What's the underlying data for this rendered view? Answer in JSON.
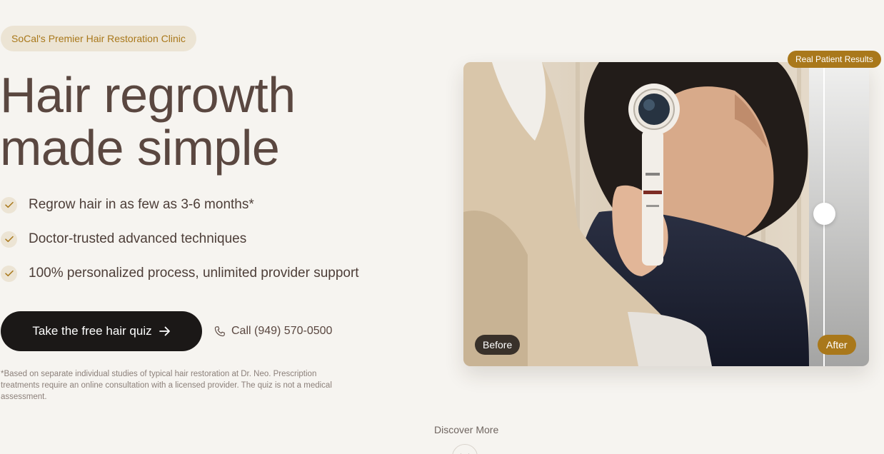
{
  "hero": {
    "eyebrow": "SoCal's Premier Hair Restoration Clinic",
    "headline_line1": "Hair regrowth",
    "headline_line2": "made simple",
    "benefits": [
      {
        "icon": "check-icon",
        "label": "Regrow hair in as few as 3-6 months*"
      },
      {
        "icon": "check-icon",
        "label": "Doctor-trusted advanced techniques"
      },
      {
        "icon": "check-icon",
        "label": "100% personalized process, unlimited provider support"
      }
    ],
    "cta": {
      "label": "Take the free hair quiz",
      "icon": "arrow-right-icon"
    },
    "call": {
      "icon": "phone-icon",
      "label": "Call (949) 570-0500"
    },
    "disclaimer": "*Based on separate individual studies of typical hair restoration at Dr. Neo. Prescription treatments require an online consultation with a licensed provider. The quiz is not a medical assessment."
  },
  "comparison": {
    "badge": "Real Patient Results",
    "before_label": "Before",
    "after_label": "After",
    "slider_position": 0.89
  },
  "discover": {
    "label": "Discover More",
    "icon": "chevron-down-icon"
  },
  "colors": {
    "background": "#f6f4f0",
    "headline": "#5a4740",
    "accent_gold": "#a9781b",
    "pill_beige": "#ece4d4",
    "button_dark": "#1b1817"
  }
}
